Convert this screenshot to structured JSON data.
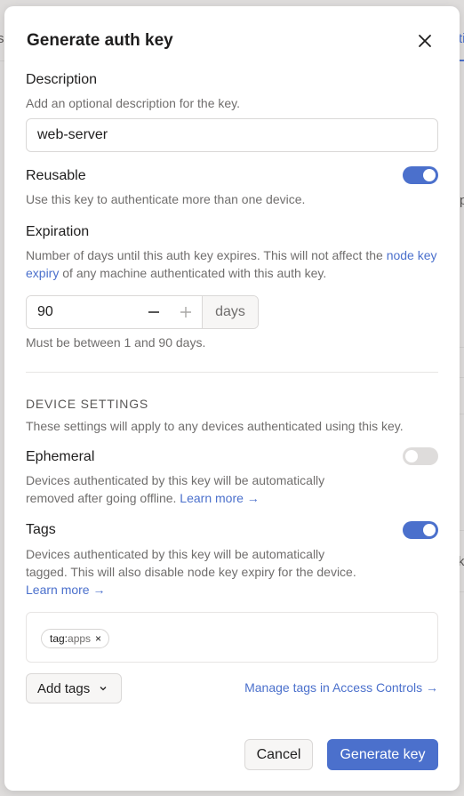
{
  "background": {
    "left_fragment": "s",
    "right_fragment_1": "ti",
    "right_fragment_2": "p",
    "right_fragment_3": "ke"
  },
  "modal": {
    "title": "Generate auth key",
    "close_icon": "close-icon"
  },
  "description": {
    "label": "Description",
    "help": "Add an optional description for the key.",
    "value": "web-server",
    "placeholder": ""
  },
  "reusable": {
    "label": "Reusable",
    "help": "Use this key to authenticate more than one device.",
    "enabled": true
  },
  "expiration": {
    "label": "Expiration",
    "help_prefix": "Number of days until this auth key expires. This will not affect the ",
    "help_link": "node key expiry",
    "help_suffix": " of any machine authenticated with this auth key.",
    "value": "90",
    "decrement_icon": "minus-icon",
    "increment_icon": "plus-icon",
    "unit": "days",
    "hint": "Must be between 1 and 90 days."
  },
  "device_settings": {
    "title": "DEVICE SETTINGS",
    "help": "These settings will apply to any devices authenticated using this key."
  },
  "ephemeral": {
    "label": "Ephemeral",
    "help_line1": "Devices authenticated by this key will be automatically",
    "help_line2": "removed after going offline. ",
    "learn_more": "Learn more →",
    "enabled": false
  },
  "tags": {
    "label": "Tags",
    "help_line1": "Devices authenticated by this key will be automatically",
    "help_line2": "tagged. This will also disable node key expiry for the device.",
    "learn_more": "Learn more →",
    "enabled": true,
    "selected": [
      {
        "prefix": "tag:",
        "value": "apps",
        "remove": "×"
      }
    ],
    "add_button": "Add tags",
    "manage_link": "Manage tags in Access Controls →"
  },
  "footer": {
    "cancel": "Cancel",
    "generate": "Generate key"
  },
  "colors": {
    "accent": "#4b70cc",
    "toggle_off": "#dedcdb",
    "text": "#1f1e1e",
    "muted": "#706e6d"
  }
}
